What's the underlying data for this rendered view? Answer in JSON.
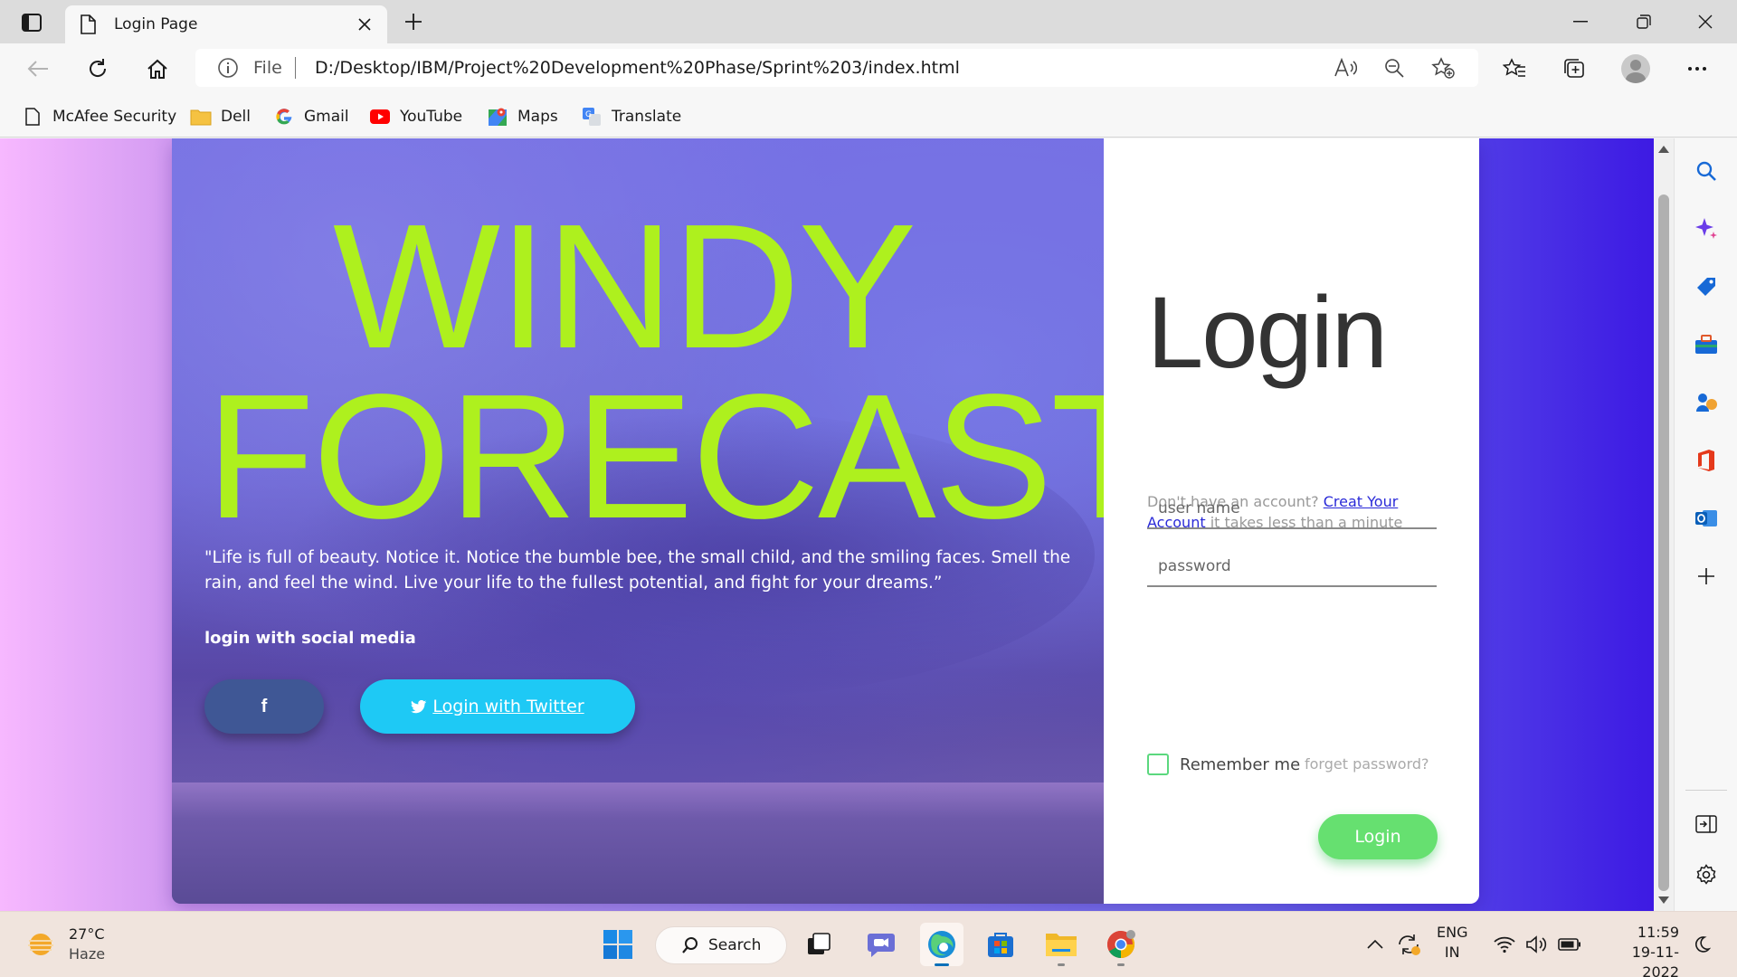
{
  "browser": {
    "tab": {
      "title": "Login Page"
    },
    "address": {
      "scheme": "File",
      "url": "D:/Desktop/IBM/Project%20Development%20Phase/Sprint%203/index.html"
    },
    "bookmarks": [
      {
        "label": "McAfee Security",
        "icon": "document-icon"
      },
      {
        "label": "Dell",
        "icon": "folder-icon"
      },
      {
        "label": "Gmail",
        "icon": "google-icon"
      },
      {
        "label": "YouTube",
        "icon": "youtube-icon"
      },
      {
        "label": "Maps",
        "icon": "maps-icon"
      },
      {
        "label": "Translate",
        "icon": "translate-icon"
      }
    ]
  },
  "hero": {
    "headline_line1": "WINDY",
    "headline_line2": "FORECAST",
    "quote": "\"Life is full of beauty. Notice it. Notice the bumble bee, the small child, and the smiling faces. Smell the rain, and feel the wind. Live your life to the fullest potential, and fight for your dreams.”",
    "social_label": "login with social media",
    "facebook_label": "f",
    "twitter_label": "Login with Twitter"
  },
  "login": {
    "title": "Login",
    "signup_prefix": "Don't have an account?",
    "signup_link": "Creat Your Account",
    "signup_suffix": "it takes less than a minute",
    "username_placeholder": "user name",
    "password_placeholder": "password",
    "remember_label": "Remember me",
    "forgot_label": "forget password?",
    "submit_label": "Login"
  },
  "colors": {
    "headline": "#aef01e",
    "twitter": "#1ec9f5",
    "facebook": "#3f5795",
    "login_button": "#66e070",
    "link": "#2a2ad8"
  },
  "taskbar": {
    "weather_temp": "27°C",
    "weather_condition": "Haze",
    "search_label": "Search",
    "lang_line1": "ENG",
    "lang_line2": "IN",
    "time": "11:59",
    "date": "19-11-2022"
  }
}
